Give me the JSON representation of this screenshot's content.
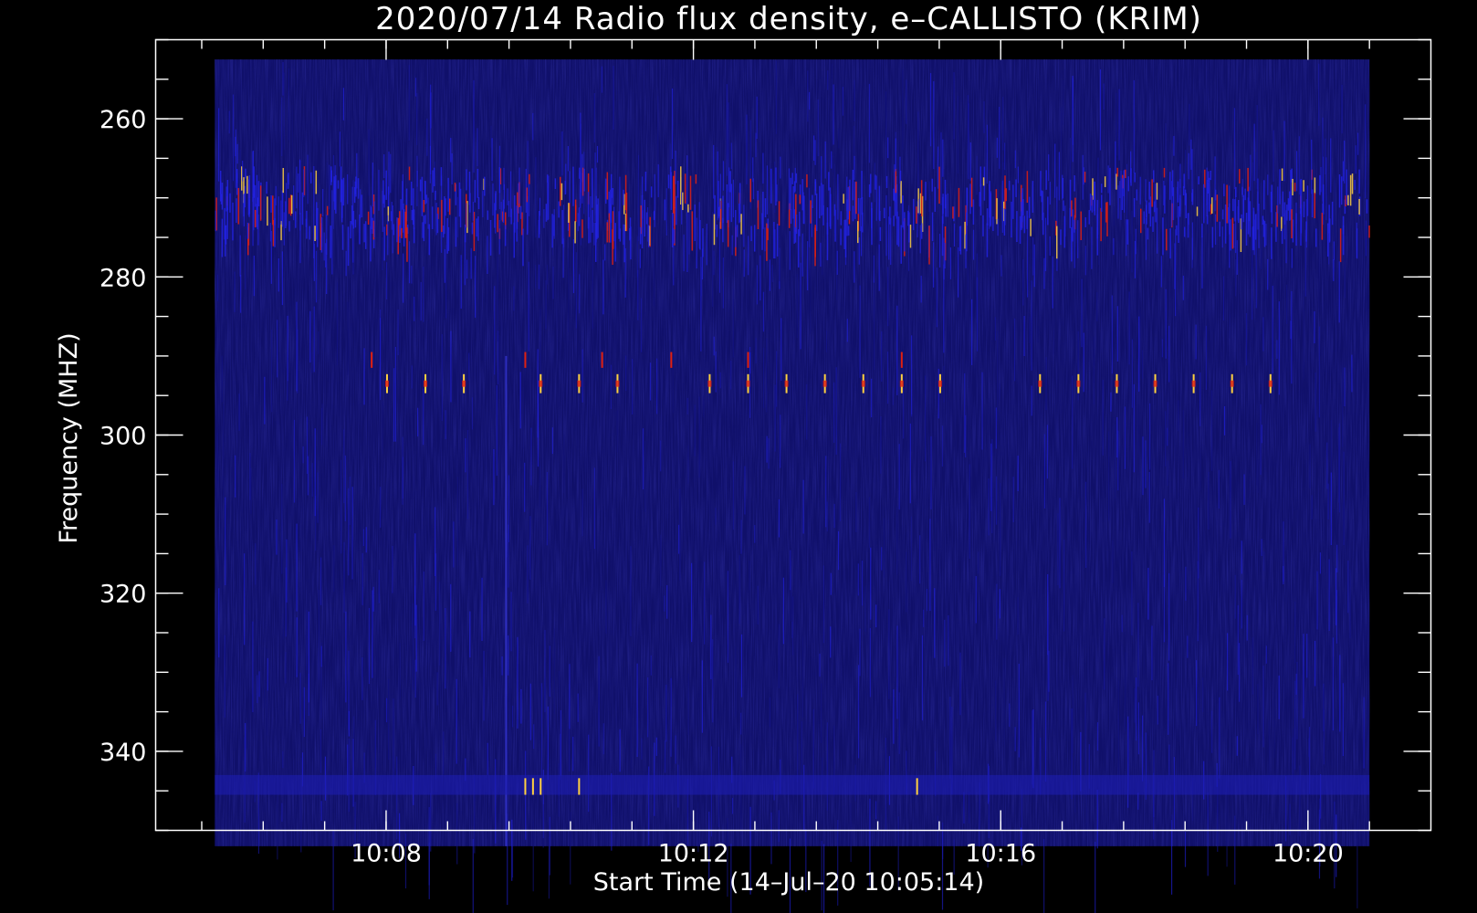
{
  "chart_data": {
    "type": "heatmap",
    "title": "2020/07/14  Radio flux density, e–CALLISTO (KRIM)",
    "xlabel": "Start Time (14–Jul–20 10:05:14)",
    "ylabel": "Frequency (MHZ)",
    "x_unit": "minutes after 10:00",
    "xlim": [
      5.0,
      21.6
    ],
    "ylim": [
      350,
      250
    ],
    "data_xrange": [
      5.77,
      20.8
    ],
    "data_yrange": [
      252.5,
      352.0
    ],
    "x_ticks": [
      {
        "value": 8,
        "label": "10:08"
      },
      {
        "value": 12,
        "label": "10:12"
      },
      {
        "value": 16,
        "label": "10:16"
      },
      {
        "value": 20,
        "label": "10:20"
      }
    ],
    "x_minor_step": 0.8,
    "y_ticks": [
      {
        "value": 260,
        "label": "260"
      },
      {
        "value": 280,
        "label": "280"
      },
      {
        "value": 300,
        "label": "300"
      },
      {
        "value": 320,
        "label": "320"
      },
      {
        "value": 340,
        "label": "340"
      }
    ],
    "y_minor_step": 5,
    "colors": {
      "background": "#000000",
      "frame": "#ffffff",
      "low": "#10106a",
      "mid": "#2222e0",
      "high": "#e02010",
      "peak": "#ffd040"
    },
    "features": {
      "interference_band_mhz": [
        266,
        274
      ],
      "burst_row_mhz": 293.5,
      "burst_times": [
        8.0,
        8.5,
        9.0,
        10.0,
        10.5,
        11.0,
        12.2,
        12.7,
        13.2,
        13.7,
        14.2,
        14.7,
        15.2,
        16.5,
        17.0,
        17.5,
        18.0,
        18.5,
        19.0,
        19.5
      ],
      "secondary_row_mhz": 290.5,
      "secondary_times": [
        7.8,
        9.8,
        10.8,
        11.7,
        12.7,
        14.7
      ],
      "bottom_band_mhz": [
        343,
        345.5
      ],
      "bottom_band_times": [
        9.8,
        9.9,
        10.0,
        10.5,
        14.9
      ],
      "vertical_line_time": 9.55
    }
  }
}
